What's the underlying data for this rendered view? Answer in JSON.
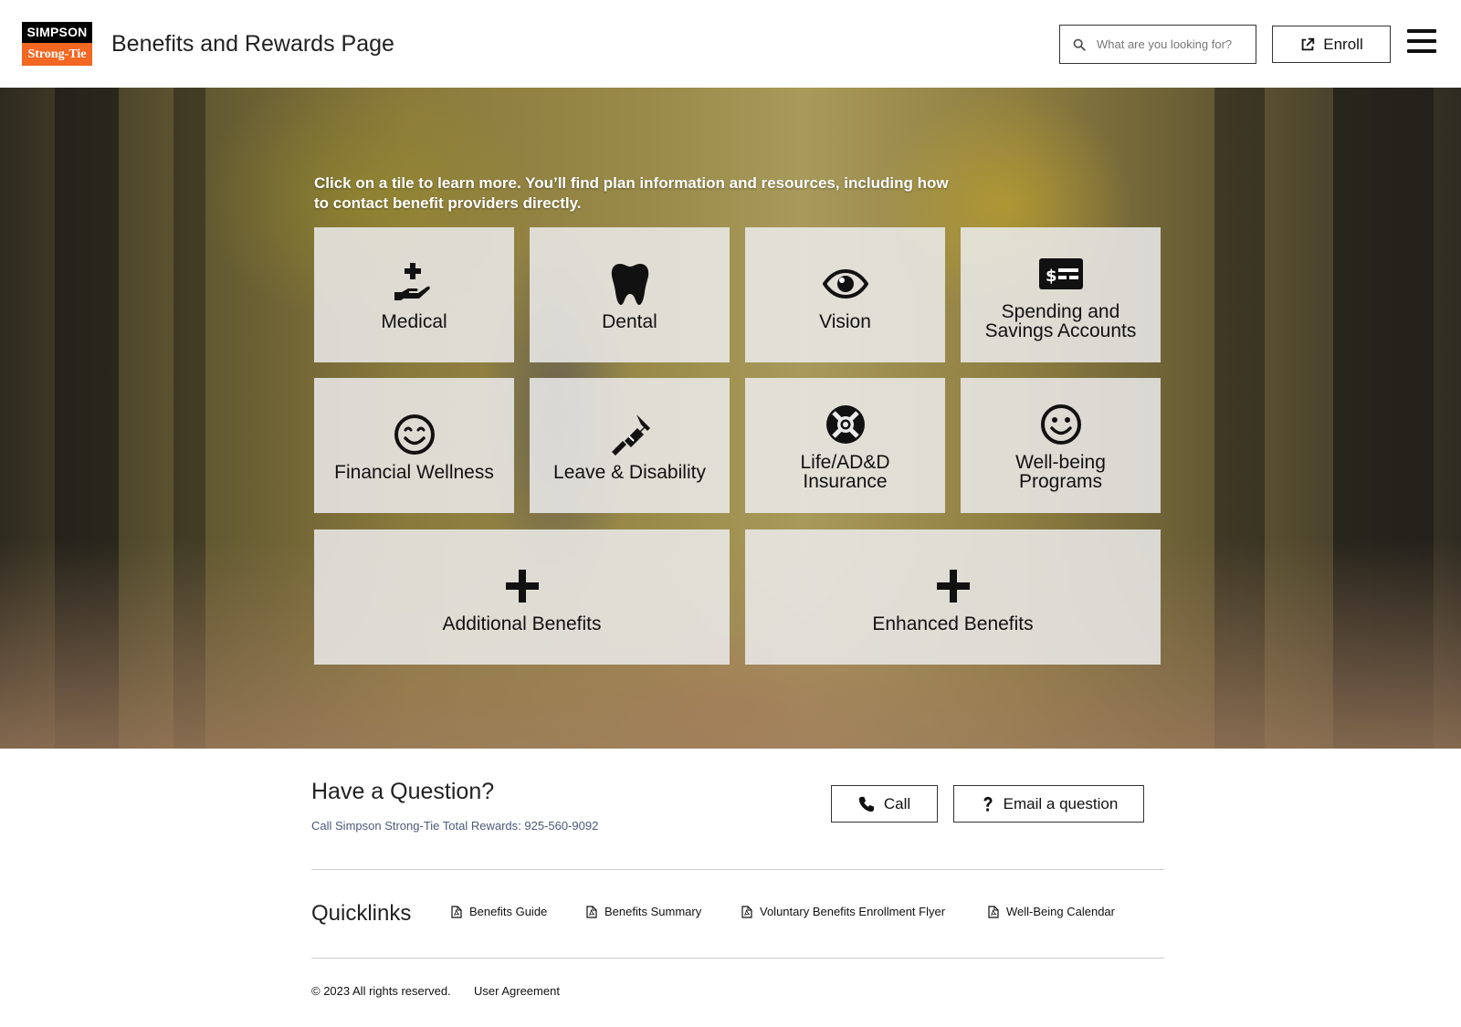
{
  "header": {
    "logo_top": "SIMPSON",
    "logo_bottom": "Strong-Tie",
    "title": "Benefits and Rewards Page",
    "search_placeholder": "What are you looking for?",
    "enroll_label": "Enroll"
  },
  "hero": {
    "intro": "Click on a tile to learn more. You’ll find plan information and resources, including how to contact benefit providers directly.",
    "tiles": [
      {
        "label": "Medical",
        "icon": "medical-hand-icon"
      },
      {
        "label": "Dental",
        "icon": "tooth-icon"
      },
      {
        "label": "Vision",
        "icon": "eye-icon"
      },
      {
        "label": "Spending and Savings Accounts",
        "icon": "money-check-icon"
      },
      {
        "label": "Financial Wellness",
        "icon": "smile-icon"
      },
      {
        "label": "Leave & Disability",
        "icon": "crutch-icon"
      },
      {
        "label": "Life/AD&D Insurance",
        "icon": "life-ring-icon"
      },
      {
        "label": "Well-being Programs",
        "icon": "smile-icon"
      },
      {
        "label": "Additional Benefits",
        "icon": "plus-icon"
      },
      {
        "label": "Enhanced Benefits",
        "icon": "plus-icon"
      }
    ]
  },
  "question": {
    "title": "Have a Question?",
    "subtitle": "Call Simpson Strong-Tie Total Rewards: 925-560-9092",
    "call_label": "Call",
    "email_label": "Email a question"
  },
  "quicklinks": {
    "title": "Quicklinks",
    "links": [
      {
        "label": "Benefits Guide"
      },
      {
        "label": "Benefits Summary"
      },
      {
        "label": "Voluntary Benefits Enrollment Flyer"
      },
      {
        "label": "Well-Being Calendar"
      }
    ]
  },
  "footer": {
    "copyright": "© 2023 All rights reserved.",
    "user_agreement": "User Agreement"
  },
  "colors": {
    "brand_orange": "#f26722",
    "brand_black": "#000000",
    "link_blue": "#4a5a78"
  }
}
